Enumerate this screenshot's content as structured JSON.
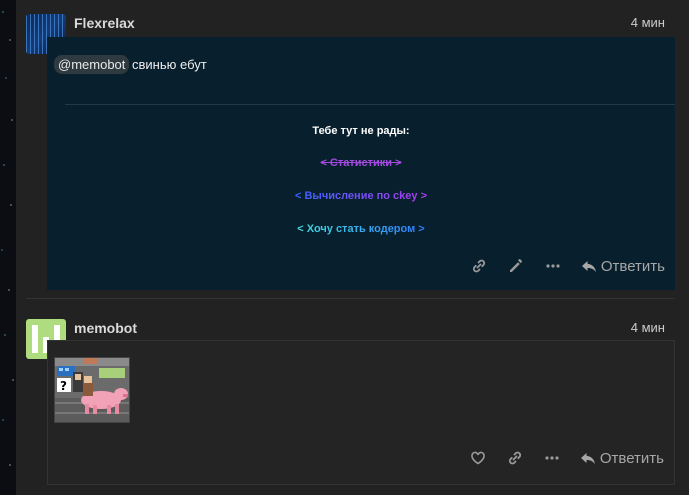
{
  "post1": {
    "username": "Flexrelax",
    "time": "4 мин",
    "mention": "@memobot",
    "message": "свинью ебут",
    "info": {
      "title": "Тебе тут не рады:",
      "link_statistics": "< Статистики >",
      "link_ckey": "< Вычисление по ckey >",
      "link_coder": "< Хочу стать кодером >"
    },
    "reply_label": "Ответить"
  },
  "post2": {
    "username": "memobot",
    "time": "4 мин",
    "reply_label": "Ответить"
  },
  "colors": {
    "bg": "#222222",
    "post_body": "#08202e",
    "avatar2": "#aedc7e",
    "purple": "#a04bdc"
  }
}
